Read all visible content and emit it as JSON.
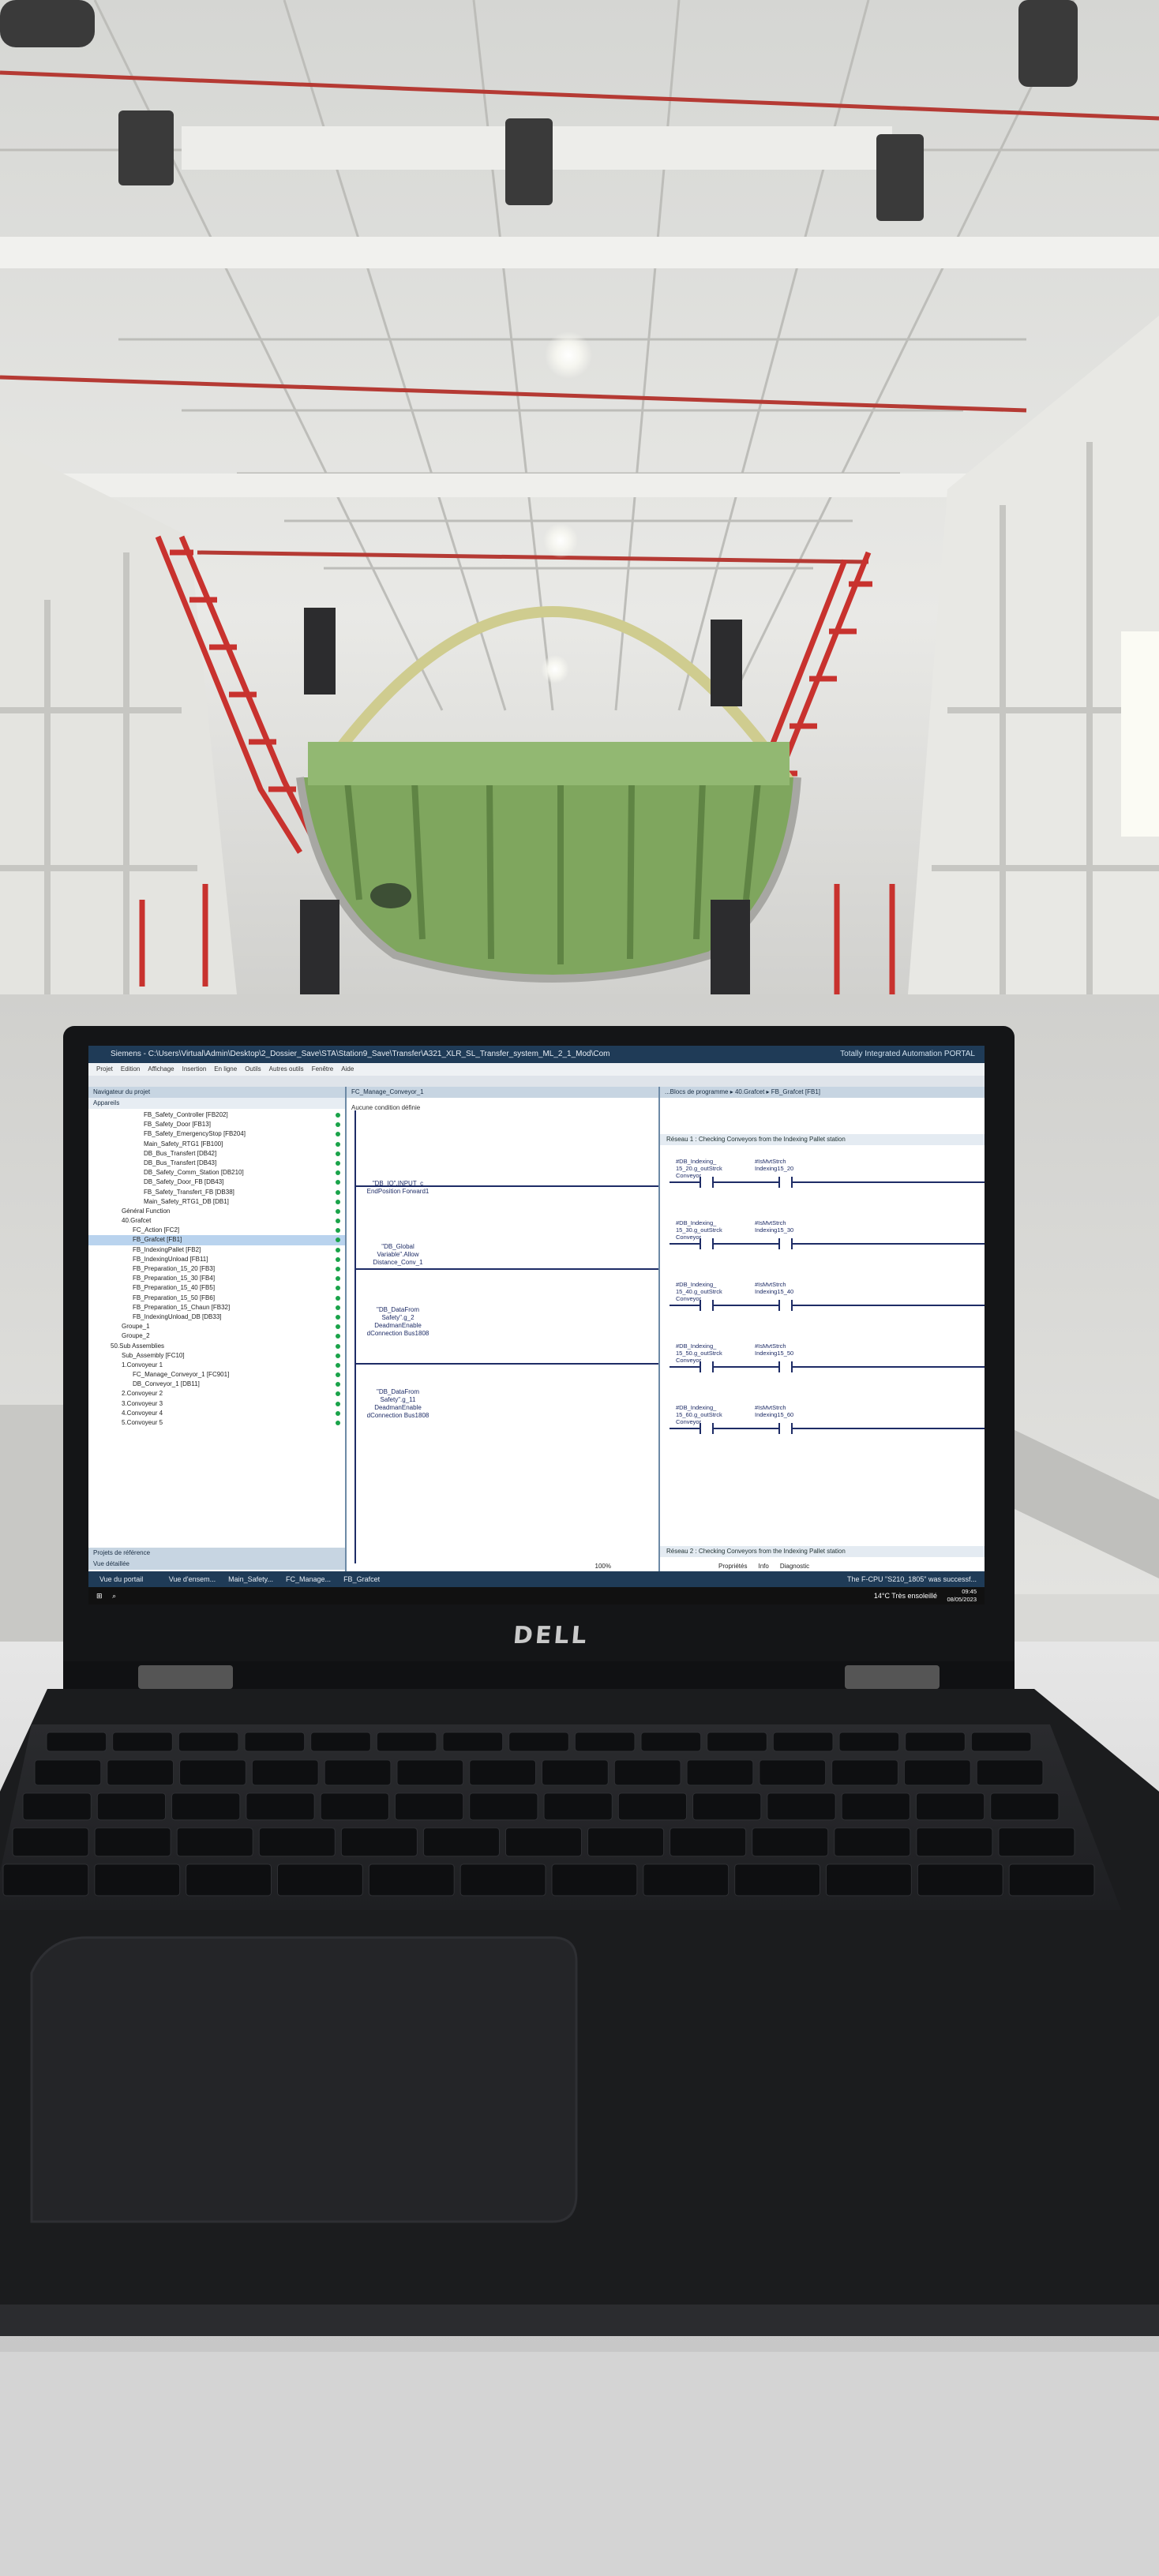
{
  "photo": {
    "subject": "laptop showing PLC programming software in an aircraft fuselage assembly hangar",
    "colors": {
      "bulkhead_green": "#7fa65e",
      "railing_red": "#c8322e",
      "ceiling_white": "#e6e6e2",
      "laptop_black": "#1b1c1e"
    }
  },
  "laptop": {
    "brand": "DELL"
  },
  "screen": {
    "window_title": "Siemens - C:\\Users\\Virtual\\Admin\\Desktop\\2_Dossier_Save\\STA\\Station9_Save\\Transfer\\A321_XLR_SL_Transfer_system_ML_2_1_Mod\\Com",
    "app_brand": "Totally Integrated Automation PORTAL",
    "menu": [
      "Projet",
      "Edition",
      "Affichage",
      "Insertion",
      "En ligne",
      "Outils",
      "Autres outils",
      "Fenêtre",
      "Aide"
    ],
    "left_pane": {
      "title": "Navigateur du projet",
      "tab": "Appareils",
      "items": [
        {
          "label": "FB_Safety_Controller [FB202]",
          "indent": 5,
          "selected": false
        },
        {
          "label": "FB_Safety_Door [FB13]",
          "indent": 5,
          "selected": false
        },
        {
          "label": "FB_Safety_EmergencyStop [FB204]",
          "indent": 5,
          "selected": false
        },
        {
          "label": "Main_Safety_RTG1 [FB100]",
          "indent": 5,
          "selected": false
        },
        {
          "label": "DB_Bus_Transfert [DB42]",
          "indent": 5,
          "selected": false
        },
        {
          "label": "DB_Bus_Transfert [DB43]",
          "indent": 5,
          "selected": false
        },
        {
          "label": "DB_Safety_Comm_Station [DB210]",
          "indent": 5,
          "selected": false
        },
        {
          "label": "DB_Safety_Door_FB [DB43]",
          "indent": 5,
          "selected": false
        },
        {
          "label": "FB_Safety_Transfert_FB [DB38]",
          "indent": 5,
          "selected": false
        },
        {
          "label": "Main_Safety_RTG1_DB [DB1]",
          "indent": 5,
          "selected": false
        },
        {
          "label": "Général Function",
          "indent": 3,
          "selected": false
        },
        {
          "label": "40.Grafcet",
          "indent": 3,
          "selected": false
        },
        {
          "label": "FC_Action [FC2]",
          "indent": 4,
          "selected": false
        },
        {
          "label": "FB_Grafcet [FB1]",
          "indent": 4,
          "selected": true
        },
        {
          "label": "FB_IndexingPallet [FB2]",
          "indent": 4,
          "selected": false
        },
        {
          "label": "FB_IndexingUnload [FB11]",
          "indent": 4,
          "selected": false
        },
        {
          "label": "FB_Preparation_15_20 [FB3]",
          "indent": 4,
          "selected": false
        },
        {
          "label": "FB_Preparation_15_30 [FB4]",
          "indent": 4,
          "selected": false
        },
        {
          "label": "FB_Preparation_15_40 [FB5]",
          "indent": 4,
          "selected": false
        },
        {
          "label": "FB_Preparation_15_50 [FB6]",
          "indent": 4,
          "selected": false
        },
        {
          "label": "FB_Preparation_15_Chaun [FB32]",
          "indent": 4,
          "selected": false
        },
        {
          "label": "FB_IndexingUnload_DB [DB33]",
          "indent": 4,
          "selected": false
        },
        {
          "label": "Groupe_1",
          "indent": 3,
          "selected": false
        },
        {
          "label": "Groupe_2",
          "indent": 3,
          "selected": false
        },
        {
          "label": "50.Sub Assemblies",
          "indent": 2,
          "selected": false
        },
        {
          "label": "Sub_Assembly [FC10]",
          "indent": 3,
          "selected": false
        },
        {
          "label": "1.Convoyeur 1",
          "indent": 3,
          "selected": false
        },
        {
          "label": "FC_Manage_Conveyor_1 [FC901]",
          "indent": 4,
          "selected": false
        },
        {
          "label": "DB_Conveyor_1 [DB11]",
          "indent": 4,
          "selected": false
        },
        {
          "label": "2.Convoyeur 2",
          "indent": 3,
          "selected": false
        },
        {
          "label": "3.Convoyeur 3",
          "indent": 3,
          "selected": false
        },
        {
          "label": "4.Convoyeur 4",
          "indent": 3,
          "selected": false
        },
        {
          "label": "5.Convoyeur 5",
          "indent": 3,
          "selected": false
        }
      ],
      "footer_1": "Projets de référence",
      "footer_2": "Vue détaillée"
    },
    "middle_pane": {
      "title": "FC_Manage_Conveyor_1",
      "subtitle": "Aucune condition définie",
      "labels": [
        "\"DB_IO\".INPUT_c\nEndPosition\nForward1",
        "\"DB_Global\nVariable\".Allow\nDistance_Conv_1",
        "\"DB_DataFrom\nSafety\".g_2\nDeadmanEnable\ndConnection\nBus1808",
        "\"DB_DataFrom\nSafety\".g_11\nDeadmanEnable\ndConnection\nBus1808"
      ],
      "zoom": "100%"
    },
    "right_pane": {
      "title": "...Blocs de programme ▸ 40.Grafcet ▸ FB_Grafcet [FB1]",
      "network_1": "Réseau 1 : Checking Conveyors from the Indexing Pallet station",
      "network_2": "Réseau 2 : Checking Conveyors from the Indexing Pallet station",
      "contacts": [
        {
          "left": "#DB_Indexing_\n15_20.g_outStrck\nConveyor",
          "right": "#IsMvtStrch\nIndexing15_20"
        },
        {
          "left": "#DB_Indexing_\n15_30.g_outStrck\nConveyor",
          "right": "#IsMvtStrch\nIndexing15_30"
        },
        {
          "left": "#DB_Indexing_\n15_40.g_outStrck\nConveyor",
          "right": "#IsMvtStrch\nIndexing15_40"
        },
        {
          "left": "#DB_Indexing_\n15_50.g_outStrck\nConveyor",
          "right": "#IsMvtStrch\nIndexing15_50"
        },
        {
          "left": "#DB_Indexing_\n15_60.g_outStrck\nConveyor",
          "right": "#IsMvtStrch\nIndexing15_60"
        }
      ],
      "tabs": [
        "Propriétés",
        "Info",
        "Diagnostic"
      ]
    },
    "status": {
      "portal_view": "Vue du portail",
      "tabs": [
        "Vue d'ensem...",
        "Main_Safety...",
        "FC_Manage...",
        "FB_Grafcet"
      ],
      "message": "The F-CPU \"S210_1805\" was successf..."
    },
    "taskbar": {
      "weather": "14°C  Très ensoleillé",
      "time": "09:45",
      "date": "08/05/2023"
    }
  }
}
